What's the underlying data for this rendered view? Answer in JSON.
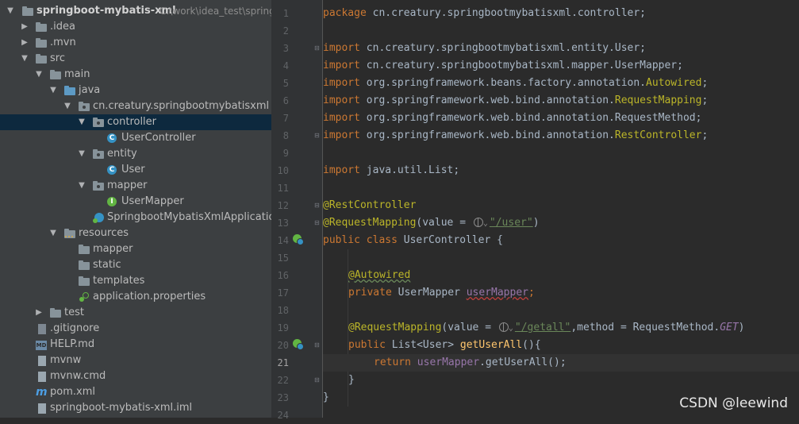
{
  "project_tree": {
    "root_name": "springboot-mybatis-xml",
    "root_path": "C:\\work\\idea_test\\spring",
    "items": [
      {
        "label": ".idea"
      },
      {
        "label": ".mvn"
      },
      {
        "label": "src"
      },
      {
        "label": "main"
      },
      {
        "label": "java"
      },
      {
        "label": "cn.creatury.springbootmybatisxml"
      },
      {
        "label": "controller"
      },
      {
        "label": "UserController"
      },
      {
        "label": "entity"
      },
      {
        "label": "User"
      },
      {
        "label": "mapper"
      },
      {
        "label": "UserMapper"
      },
      {
        "label": "SpringbootMybatisXmlApplication"
      },
      {
        "label": "resources"
      },
      {
        "label": "mapper"
      },
      {
        "label": "static"
      },
      {
        "label": "templates"
      },
      {
        "label": "application.properties"
      },
      {
        "label": "test"
      },
      {
        "label": ".gitignore"
      },
      {
        "label": "HELP.md"
      },
      {
        "label": "mvnw"
      },
      {
        "label": "mvnw.cmd"
      },
      {
        "label": "pom.xml"
      },
      {
        "label": "springboot-mybatis-xml.iml"
      }
    ]
  },
  "editor": {
    "line_numbers": [
      "1",
      "2",
      "3",
      "4",
      "5",
      "6",
      "7",
      "8",
      "9",
      "10",
      "11",
      "12",
      "13",
      "14",
      "15",
      "16",
      "17",
      "18",
      "19",
      "20",
      "21",
      "22",
      "23",
      "24"
    ],
    "current_line": "21",
    "code": {
      "l1_kw": "package",
      "l1_rest": " cn.creatury.springbootmybatisxml.controller;",
      "import_kw": "import",
      "l3_rest": " cn.creatury.springbootmybatisxml.entity.User;",
      "l4_rest": " cn.creatury.springbootmybatisxml.mapper.UserMapper;",
      "l5_pre": " org.springframework.beans.factory.annotation.",
      "l5_cls": "Autowired",
      "l6_pre": " org.springframework.web.bind.annotation.",
      "l6_cls": "RequestMapping",
      "l7_rest": " org.springframework.web.bind.annotation.RequestMethod;",
      "l8_pre": " org.springframework.web.bind.annotation.",
      "l8_cls": "RestController",
      "semicolon": ";",
      "l10_rest": " java.util.List;",
      "l12_ann": "@RestController",
      "l13_ann": "@RequestMapping",
      "l13_pre": "(value = ",
      "l13_str": "\"/user\"",
      "l13_post": ")",
      "l14_kw": "public class",
      "l14_rest": " UserController {",
      "l16_ann": "@Autowired",
      "l17_kw": "private",
      "l17_type": " UserMapper ",
      "l17_field": "userMapper",
      "l19_ann": "@RequestMapping",
      "l19_pre": "(value = ",
      "l19_str": "\"/getall\"",
      "l19_mid": ",method = RequestMethod.",
      "l19_enum": "GET",
      "l19_post": ")",
      "l20_kw": "public",
      "l20_type": " List<User> ",
      "l20_method": "getUserAll",
      "l20_post": "(){",
      "l21_kw": "return",
      "l21_field": "userMapper",
      "l21_post": ".getUserAll();",
      "l22": "}",
      "l23": "}"
    }
  },
  "watermark": "CSDN @leewind",
  "colors": {
    "keyword": "#cc7832",
    "annotation": "#bbb529",
    "string": "#6a8759",
    "field": "#9876aa",
    "method": "#ffc66d",
    "text": "#a9b7c6",
    "selected_row": "#0d293e"
  }
}
